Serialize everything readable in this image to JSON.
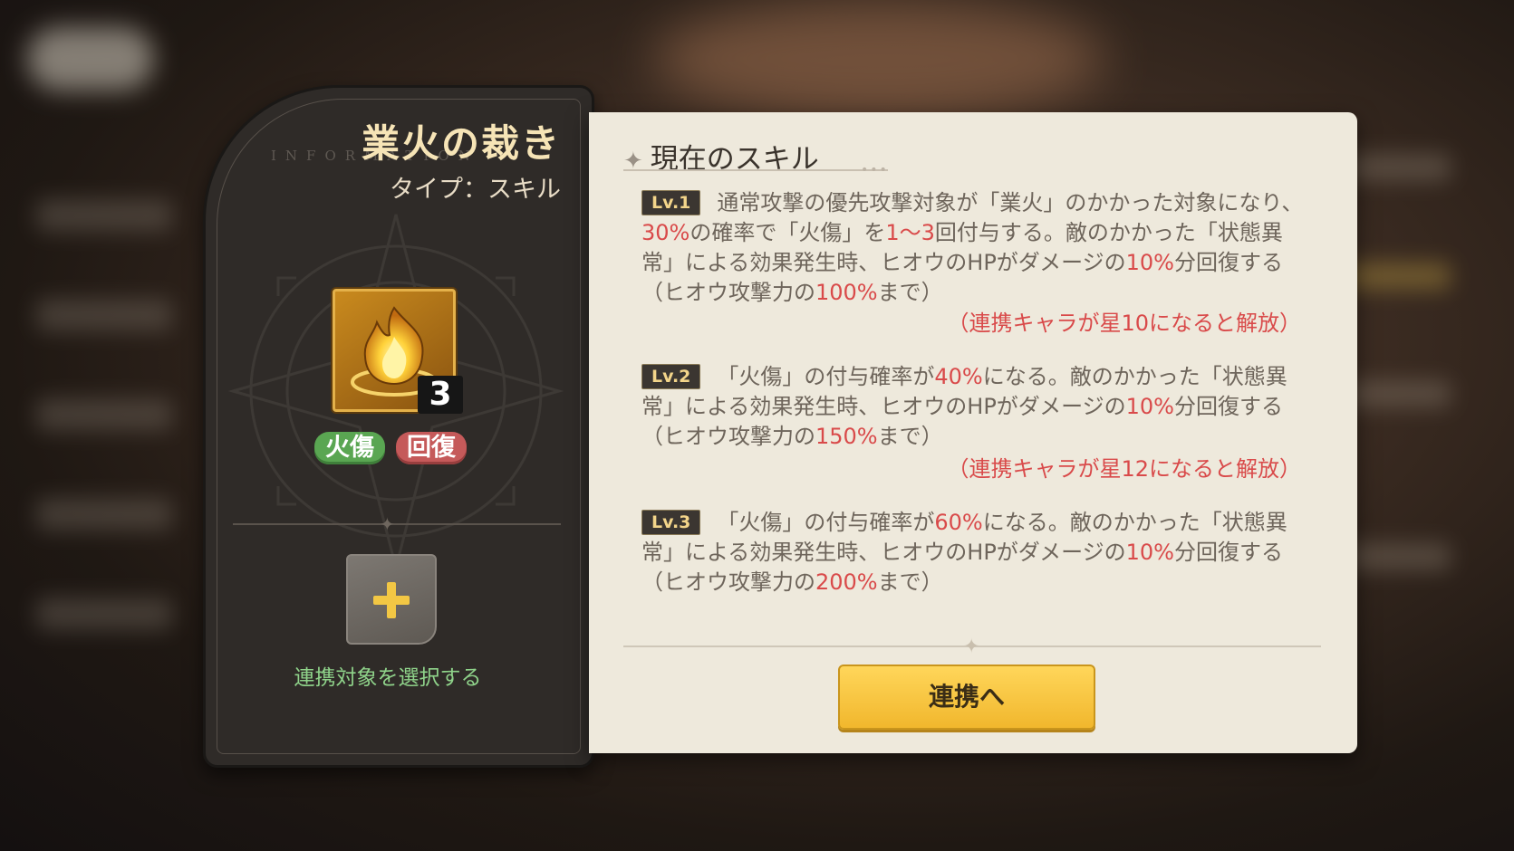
{
  "skill": {
    "title": "業火の裁き",
    "watermark": "INFORMATION",
    "type_label": "タイプ：スキル",
    "icon": "fire-skill-icon",
    "level": "3",
    "tags": [
      "火傷",
      "回復"
    ],
    "link_slot_label": "連携対象を選択する"
  },
  "panel": {
    "section_title": "現在のスキル",
    "levels": [
      {
        "badge": "Lv.1",
        "segments": [
          {
            "t": "通常攻撃の優先攻撃対象が「業火」のかかった対象になり、"
          },
          {
            "t": "30%",
            "hl": true
          },
          {
            "t": "の確率で「火傷」を"
          },
          {
            "t": "1〜3",
            "hl": true
          },
          {
            "t": "回付与する。敵のかかった「状態異常」による効果発生時、ヒオウのHPがダメージの"
          },
          {
            "t": "10%",
            "hl": true
          },
          {
            "t": "分回復する（ヒオウ攻撃力の"
          },
          {
            "t": "100%",
            "hl": true
          },
          {
            "t": "まで）"
          }
        ],
        "unlock": "（連携キャラが星10になると解放）"
      },
      {
        "badge": "Lv.2",
        "segments": [
          {
            "t": "「火傷」の付与確率が"
          },
          {
            "t": "40%",
            "hl": true
          },
          {
            "t": "になる。敵のかかった「状態異常」による効果発生時、ヒオウのHPがダメージの"
          },
          {
            "t": "10%",
            "hl": true
          },
          {
            "t": "分回復する（ヒオウ攻撃力の"
          },
          {
            "t": "150%",
            "hl": true
          },
          {
            "t": "まで）"
          }
        ],
        "unlock": "（連携キャラが星12になると解放）"
      },
      {
        "badge": "Lv.3",
        "segments": [
          {
            "t": "「火傷」の付与確率が"
          },
          {
            "t": "60%",
            "hl": true
          },
          {
            "t": "になる。敵のかかった「状態異常」による効果発生時、ヒオウのHPがダメージの"
          },
          {
            "t": "10%",
            "hl": true
          },
          {
            "t": "分回復する（ヒオウ攻撃力の"
          },
          {
            "t": "200%",
            "hl": true
          },
          {
            "t": "まで）"
          }
        ],
        "unlock": ""
      }
    ],
    "button_label": "連携へ"
  },
  "colors": {
    "highlight": "#d94a4a",
    "button": "#f5c43c",
    "tag_burn": "#5aa652",
    "tag_heal": "#c55a5a"
  }
}
